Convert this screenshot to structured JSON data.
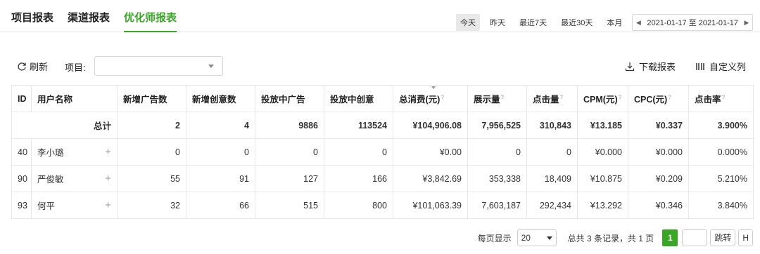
{
  "tabs": [
    {
      "label": "项目报表",
      "active": false
    },
    {
      "label": "渠道报表",
      "active": false
    },
    {
      "label": "优化师报表",
      "active": true
    }
  ],
  "date_buttons": [
    "今天",
    "昨天",
    "最近7天",
    "最近30天",
    "本月"
  ],
  "date_range": "2021-01-17 至 2021-01-17",
  "toolbar": {
    "refresh_label": "刷新",
    "project_label": "项目:",
    "project_value": "",
    "download_label": "下载报表",
    "custom_columns_label": "自定义列"
  },
  "columns": [
    "ID",
    "用户名称",
    "新增广告数",
    "新增创意数",
    "投放中广告",
    "投放中创意",
    "总消费(元)",
    "展示量",
    "点击量",
    "CPM(元)",
    "CPC(元)",
    "点击率"
  ],
  "summary": {
    "label": "总计",
    "new_ads": "2",
    "new_creatives": "4",
    "active_ads": "9886",
    "active_creatives": "113524",
    "cost": "¥104,906.08",
    "impressions": "7,956,525",
    "clicks": "310,843",
    "cpm": "¥13.185",
    "cpc": "¥0.337",
    "ctr": "3.900%"
  },
  "rows": [
    {
      "id": "40",
      "name": "李小璐",
      "new_ads": "0",
      "new_creatives": "0",
      "active_ads": "0",
      "active_creatives": "0",
      "cost": "¥0.00",
      "impressions": "0",
      "clicks": "0",
      "cpm": "¥0.000",
      "cpc": "¥0.000",
      "ctr": "0.000%"
    },
    {
      "id": "90",
      "name": "严俊敏",
      "new_ads": "55",
      "new_creatives": "91",
      "active_ads": "127",
      "active_creatives": "166",
      "cost": "¥3,842.69",
      "impressions": "353,338",
      "clicks": "18,409",
      "cpm": "¥10.875",
      "cpc": "¥0.209",
      "ctr": "5.210%"
    },
    {
      "id": "93",
      "name": "何平",
      "new_ads": "32",
      "new_creatives": "66",
      "active_ads": "515",
      "active_creatives": "800",
      "cost": "¥101,063.39",
      "impressions": "7,603,187",
      "clicks": "292,434",
      "cpm": "¥13.292",
      "cpc": "¥0.346",
      "ctr": "3.840%"
    }
  ],
  "pager": {
    "per_page_label": "每页显示",
    "per_page_value": "20",
    "total_text": "总共 3 条记录，共 1 页",
    "current_page": "1",
    "jump_label": "跳转",
    "extra_label": "H"
  },
  "colors": {
    "accent": "#3aa626"
  }
}
